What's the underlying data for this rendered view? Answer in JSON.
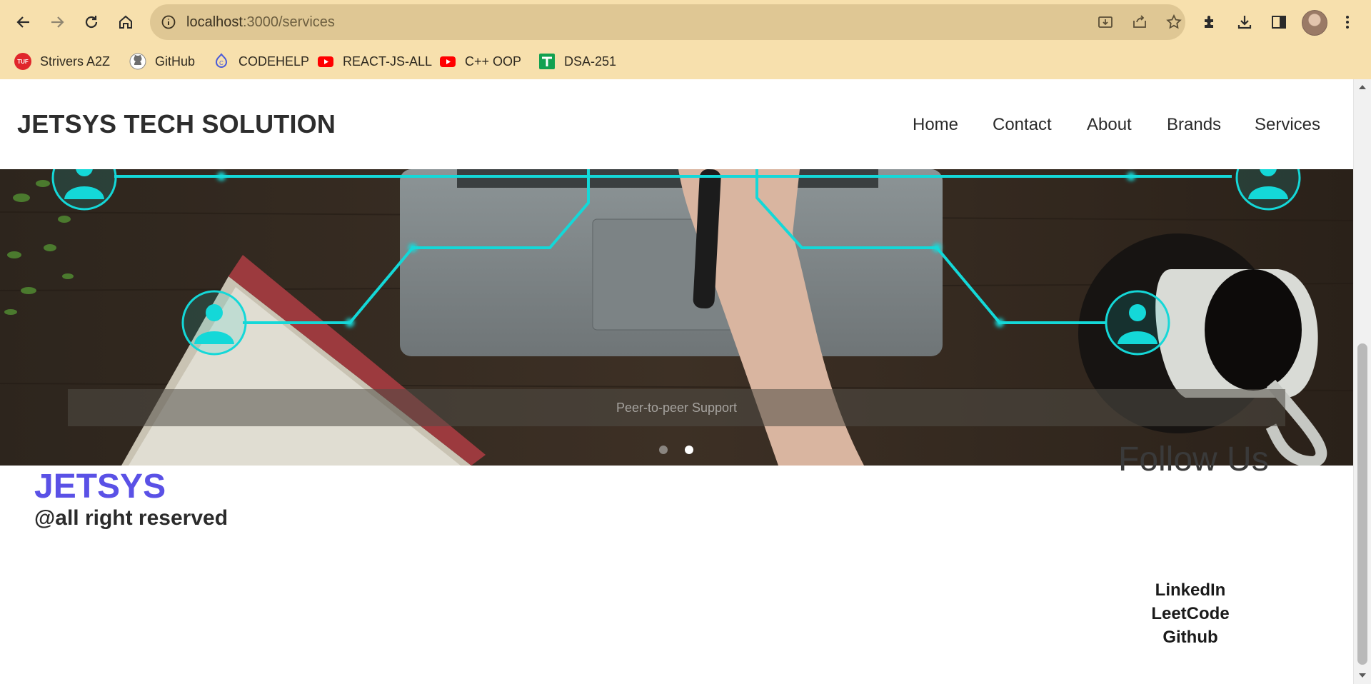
{
  "browser": {
    "url_host": "localhost",
    "url_path": ":3000/services",
    "bookmarks": [
      {
        "label": "Strivers A2Z",
        "icon": "tuf-icon"
      },
      {
        "label": "GitHub",
        "icon": "github-icon"
      },
      {
        "label": "CODEHELP",
        "icon": "codehelp-icon"
      },
      {
        "label": "REACT-JS-ALL",
        "icon": "youtube-icon"
      },
      {
        "label": "C++ OOP",
        "icon": "youtube-icon"
      },
      {
        "label": "DSA-251",
        "icon": "sheets-icon"
      }
    ]
  },
  "header": {
    "brand": "JETSYS TECH SOLUTION",
    "nav": [
      "Home",
      "Contact",
      "About",
      "Brands",
      "Services"
    ]
  },
  "carousel": {
    "caption": "Peer-to-peer Support",
    "slide_count": 2,
    "active_slide": 2
  },
  "footer": {
    "logo": "JETSYS",
    "rights": "@all right reserved",
    "follow_title": "Follow Us",
    "links": [
      "LinkedIn",
      "LeetCode",
      "Github"
    ]
  },
  "colors": {
    "chrome_bg": "#f7e0ad",
    "accent_cyan": "#14d8d8",
    "footer_logo": "#5a51e6"
  }
}
